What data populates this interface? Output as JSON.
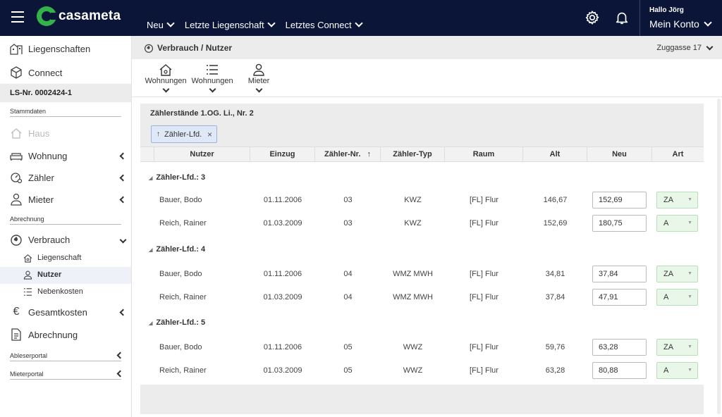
{
  "topbar": {
    "logo_text": "casameta",
    "nav": [
      {
        "label": "Neu"
      },
      {
        "label": "Letzte Liegenschaft"
      },
      {
        "label": "Letztes Connect"
      }
    ],
    "greeting": "Hallo Jörg",
    "account_label": "Mein Konto"
  },
  "sidebar": {
    "top_items": [
      {
        "label": "Liegenschaften",
        "icon": "buildings-icon"
      },
      {
        "label": "Connect",
        "icon": "cube-icon"
      }
    ],
    "ls_number": "LS-Nr. 0002424-1",
    "section_stammdaten": "Stammdaten",
    "stammdaten_items": [
      {
        "label": "Haus",
        "icon": "house-icon",
        "disabled": true
      },
      {
        "label": "Wohnung",
        "icon": "sofa-icon"
      },
      {
        "label": "Zähler",
        "icon": "meter-icon"
      },
      {
        "label": "Mieter",
        "icon": "person-icon"
      }
    ],
    "section_abrechnung": "Abrechnung",
    "verbrauch_label": "Verbrauch",
    "verbrauch_sub": [
      {
        "label": "Liegenschaft",
        "icon": "house-outline-icon"
      },
      {
        "label": "Nutzer",
        "icon": "person-icon",
        "active": true
      },
      {
        "label": "Nebenkosten",
        "icon": "list-icon"
      }
    ],
    "gesamtkosten_label": "Gesamtkosten",
    "abrechnung_label": "Abrechnung",
    "section_ableserportal": "Ableserportal",
    "section_mieterportal": "Mieterportal"
  },
  "header": {
    "title": "Verbrauch / Nutzer",
    "address": "Zuggasse 17"
  },
  "toolbar": {
    "buttons": [
      {
        "label": "Wohnungen",
        "icon": "house-gear-icon"
      },
      {
        "label": "Wohnungen",
        "icon": "list-icon"
      },
      {
        "label": "Mieter",
        "icon": "person-icon"
      }
    ]
  },
  "panel": {
    "title": "Zählerstände 1.OG. Li., Nr. 2",
    "chip": {
      "arrow": "↑",
      "label": "Zähler-Lfd.",
      "close": "×"
    },
    "columns": [
      "Nutzer",
      "Einzug",
      "Zähler-Nr.",
      "Zähler-Typ",
      "Raum",
      "Alt",
      "Neu",
      "Art"
    ],
    "sort_indicator": "↑",
    "groups": [
      {
        "label": "Zähler-Lfd.: 3",
        "rows": [
          {
            "nutzer": "Bauer, Bodo",
            "einzug": "01.11.2006",
            "nr": "03",
            "typ": "KWZ",
            "raum": "[FL] Flur",
            "alt": "146,67",
            "neu": "152,69",
            "art": "ZA"
          },
          {
            "nutzer": "Reich, Rainer",
            "einzug": "01.03.2009",
            "nr": "03",
            "typ": "KWZ",
            "raum": "[FL] Flur",
            "alt": "152,69",
            "neu": "180,75",
            "art": "A"
          }
        ]
      },
      {
        "label": "Zähler-Lfd.: 4",
        "rows": [
          {
            "nutzer": "Bauer, Bodo",
            "einzug": "01.11.2006",
            "nr": "04",
            "typ": "WMZ MWH",
            "raum": "[FL] Flur",
            "alt": "34,81",
            "neu": "37,84",
            "art": "ZA"
          },
          {
            "nutzer": "Reich, Rainer",
            "einzug": "01.03.2009",
            "nr": "04",
            "typ": "WMZ MWH",
            "raum": "[FL] Flur",
            "alt": "37,84",
            "neu": "47,91",
            "art": "A"
          }
        ]
      },
      {
        "label": "Zähler-Lfd.: 5",
        "rows": [
          {
            "nutzer": "Bauer, Bodo",
            "einzug": "01.11.2006",
            "nr": "05",
            "typ": "WWZ",
            "raum": "[FL] Flur",
            "alt": "59,76",
            "neu": "63,28",
            "art": "ZA"
          },
          {
            "nutzer": "Reich, Rainer",
            "einzug": "01.03.2009",
            "nr": "05",
            "typ": "WWZ",
            "raum": "[FL] Flur",
            "alt": "63,28",
            "neu": "80,88",
            "art": "A"
          }
        ]
      }
    ]
  },
  "colors": {
    "topbar_bg": "#0b1538",
    "logo_green": "#34b24a",
    "select_bg": "#e9f7e9"
  }
}
